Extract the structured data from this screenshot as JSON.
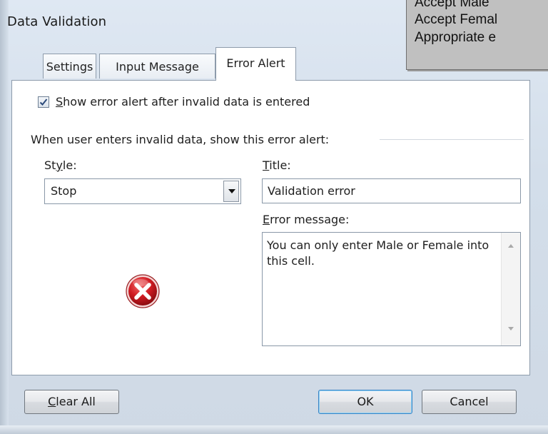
{
  "dialog": {
    "title": "Data Validation"
  },
  "callout": {
    "lines": [
      "Accept Male",
      "Accept Femal",
      "Appropriate e"
    ]
  },
  "tabs": [
    {
      "label": "Settings",
      "active": false
    },
    {
      "label": "Input Message",
      "active": false
    },
    {
      "label": "Error Alert",
      "active": true
    }
  ],
  "error_alert": {
    "show_checkbox": {
      "checked": true,
      "mnemonic": "S",
      "label_rest": "how error alert after invalid data is entered"
    },
    "section_label": "When user enters invalid data, show this error alert:",
    "style": {
      "label_pre": "St",
      "mnemonic": "y",
      "label_post": "le:",
      "value": "Stop"
    },
    "title_field": {
      "mnemonic": "T",
      "label_rest": "itle:",
      "value": "Validation error"
    },
    "message_field": {
      "mnemonic": "E",
      "label_rest": "rror message:",
      "value": "You can only enter Male or Female into this cell."
    },
    "icon": "stop-error-icon"
  },
  "buttons": {
    "clear_all": {
      "mnemonic": "C",
      "label_rest": "lear All"
    },
    "ok": "OK",
    "cancel": "Cancel"
  },
  "colors": {
    "dialog_frame": "#d3deea",
    "callout_bg": "#c0c0c0",
    "stop_icon_red": "#c8161e",
    "default_button_border": "#3b84c4"
  }
}
